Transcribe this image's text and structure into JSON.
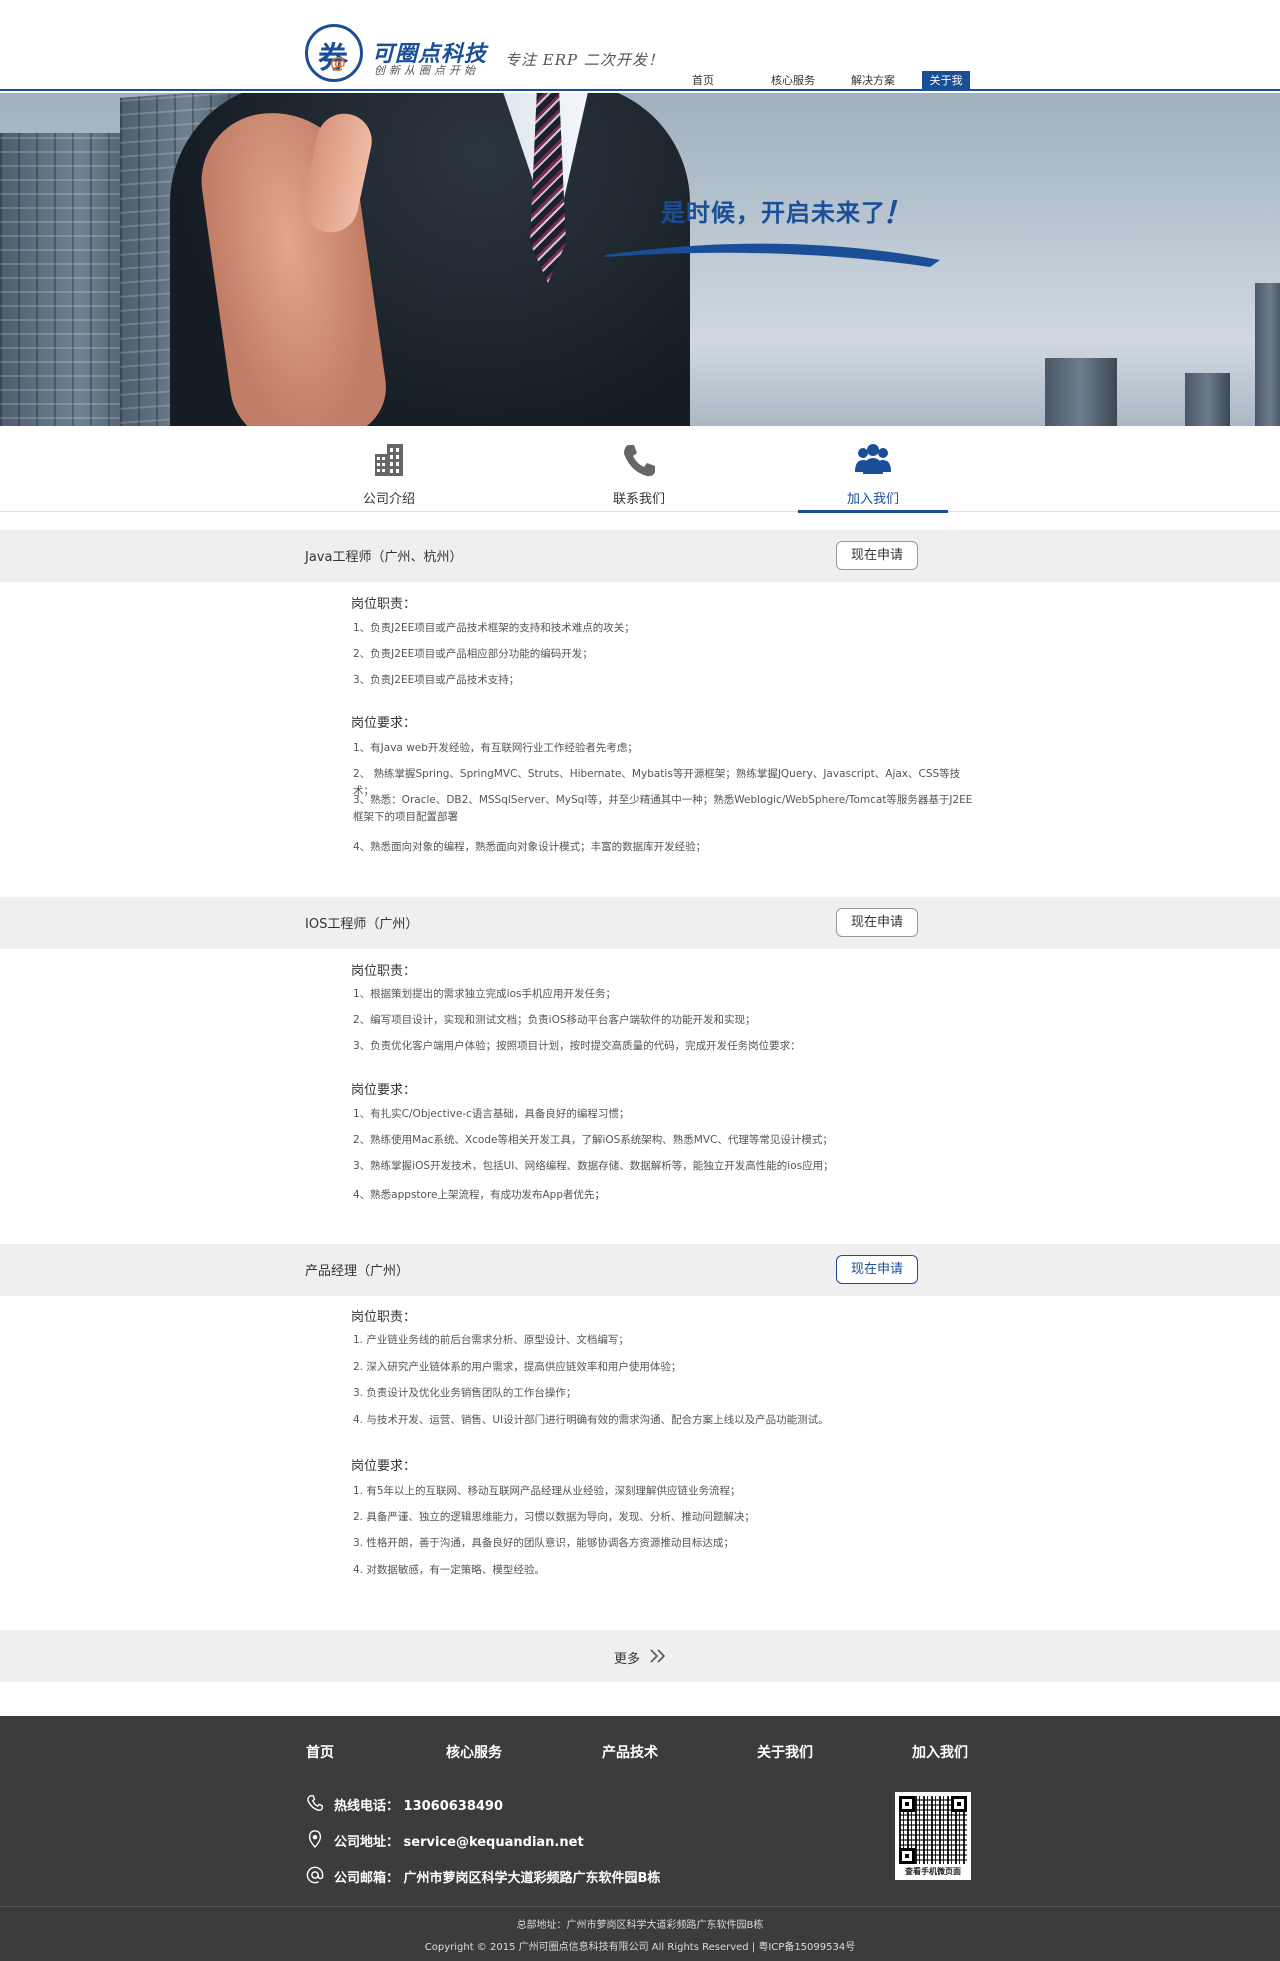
{
  "header": {
    "logo_glyph": "券",
    "logo_at": "@",
    "logo_name": "可圈点科技",
    "logo_sub": "创新从圈点开始",
    "slogan": "专注 ERP 二次开发！",
    "nav": [
      "首页",
      "核心服务",
      "解决方案",
      "关于我们"
    ],
    "active_nav": "关于我们"
  },
  "banner": {
    "title": "是时候，开启未来了",
    "exclaim": "！"
  },
  "tabs": [
    {
      "label": "公司介绍",
      "icon": "building-icon"
    },
    {
      "label": "联系我们",
      "icon": "phone-icon"
    },
    {
      "label": "加入我们",
      "icon": "people-icon",
      "active": true
    }
  ],
  "jobs": [
    {
      "title": "Java工程师（广州、杭州）",
      "apply": "现在申请",
      "duties_title": "岗位职责：",
      "duties": [
        "1、负责J2EE项目或产品技术框架的支持和技术难点的攻关；",
        "2、负责J2EE项目或产品相应部分功能的编码开发；",
        "3、负责J2EE项目或产品技术支持；"
      ],
      "req_title": "岗位要求：",
      "reqs": [
        "1、有Java web开发经验，有互联网行业工作经验者先考虑；",
        "2、 熟练掌握Spring、SpringMVC、Struts、Hibernate、Mybatis等开源框架；熟练掌握JQuery、Javascript、Ajax、CSS等技术；",
        "3、熟悉：Oracle、DB2、MSSqlServer、MySql等，并至少精通其中一种；熟悉Weblogic/WebSphere/Tomcat等服务器基于J2EE框架下的项目配置部署",
        "4、熟悉面向对象的编程，熟悉面向对象设计模式；丰富的数据库开发经验；"
      ]
    },
    {
      "title": "IOS工程师（广州）",
      "apply": "现在申请",
      "duties_title": "岗位职责：",
      "duties": [
        "1、根据策划提出的需求独立完成ios手机应用开发任务；",
        "2、编写项目设计，实现和测试文档；负责iOS移动平台客户端软件的功能开发和实现；",
        "3、负责优化客户端用户体验；按照项目计划，按时提交高质量的代码，完成开发任务岗位要求："
      ],
      "req_title": "岗位要求：",
      "reqs": [
        "1、有扎实C/Objective-c语言基础，具备良好的编程习惯；",
        "2、熟练使用Mac系统、Xcode等相关开发工具，了解iOS系统架构、熟悉MVC、代理等常见设计模式；",
        "3、熟练掌握iOS开发技术，包括UI、网络编程、数据存储、数据解析等，能独立开发高性能的ios应用；",
        "4、熟悉appstore上架流程，有成功发布App者优先；"
      ]
    },
    {
      "title": "产品经理（广州）",
      "apply": "现在申请",
      "duties_title": "岗位职责：",
      "duties": [
        "1. 产业链业务线的前后台需求分析、原型设计、文档编写；",
        "2. 深入研究产业链体系的用户需求，提高供应链效率和用户使用体验；",
        "3. 负责设计及优化业务销售团队的工作台操作；",
        "4. 与技术开发、运营、销售、UI设计部门进行明确有效的需求沟通、配合方案上线以及产品功能测试。"
      ],
      "req_title": "岗位要求：",
      "reqs": [
        "1. 有5年以上的互联网、移动互联网产品经理从业经验，深刻理解供应链业务流程；",
        "2. 具备严谨、独立的逻辑思维能力，习惯以数据为导向，发现、分析、推动问题解决；",
        "3. 性格开朗，善于沟通，具备良好的团队意识，能够协调各方资源推动目标达成；",
        "4. 对数据敏感，有一定策略、模型经验。"
      ]
    }
  ],
  "more": {
    "label": "更多"
  },
  "footer": {
    "nav": [
      "首页",
      "核心服务",
      "产品技术",
      "关于我们",
      "加入我们"
    ],
    "phone": "热线电话： 13060638490",
    "email": "公司地址： service@kequandian.net",
    "address": "公司邮箱： 广州市萝岗区科学大道彩频路广东软件园B栋",
    "qr_caption": "查看手机微页面",
    "addr_line": "总部地址：广州市萝岗区科学大道彩频路广东软件园B栋",
    "copyright": "Copyright © 2015 广州可圈点信息科技有限公司 All Rights Reserved | 粤ICP备15099534号"
  },
  "colors": {
    "brand": "#1a4f98",
    "footer_bg": "#3c3c3c",
    "band_bg": "#efefef"
  }
}
